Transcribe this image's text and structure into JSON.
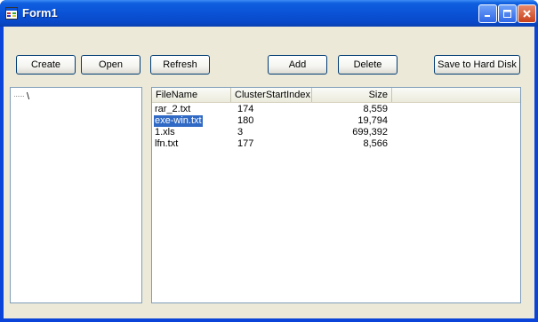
{
  "window": {
    "title": "Form1"
  },
  "toolbar": {
    "create_label": "Create",
    "open_label": "Open",
    "refresh_label": "Refresh",
    "add_label": "Add",
    "delete_label": "Delete",
    "save_label": "Save to Hard Disk"
  },
  "tree": {
    "root_label": "\\"
  },
  "list": {
    "columns": [
      "FileName",
      "ClusterStartIndex",
      "Size"
    ],
    "rows": [
      {
        "filename": "rar_2.txt",
        "cluster": "174",
        "size": "8,559",
        "selected": false
      },
      {
        "filename": "exe-win.txt",
        "cluster": "180",
        "size": "19,794",
        "selected": true
      },
      {
        "filename": "1.xls",
        "cluster": "3",
        "size": "699,392",
        "selected": false
      },
      {
        "filename": "lfn.txt",
        "cluster": "177",
        "size": "8,566",
        "selected": false
      }
    ]
  },
  "colors": {
    "titlebar": "#0a52d6",
    "client": "#ece9d8",
    "selection": "#316ac5"
  }
}
